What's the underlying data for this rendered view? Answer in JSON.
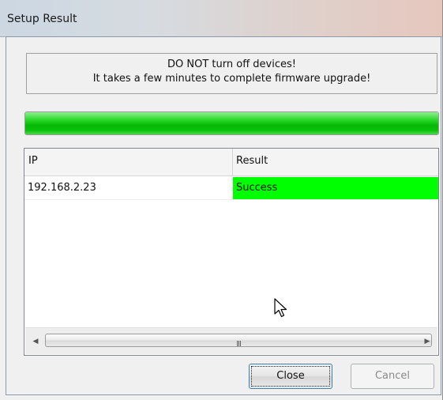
{
  "window": {
    "title": "Setup Result"
  },
  "message": {
    "line1": "DO NOT turn off devices!",
    "line2": "It takes a few minutes to complete firmware upgrade!"
  },
  "progress": {
    "value": 1.0,
    "fill_color": "#0fc40f"
  },
  "results_table": {
    "columns": [
      "IP",
      "Result"
    ],
    "rows": [
      {
        "ip": "192.168.2.23",
        "result": "Success",
        "result_color": "#00ff00"
      }
    ]
  },
  "scrollbar": {
    "left_arrow": "◀",
    "right_arrow": "▶",
    "grip": "III"
  },
  "buttons": {
    "close_label": "Close",
    "cancel_label": "Cancel"
  },
  "icons": {
    "cursor": "pointer-cursor-icon"
  }
}
